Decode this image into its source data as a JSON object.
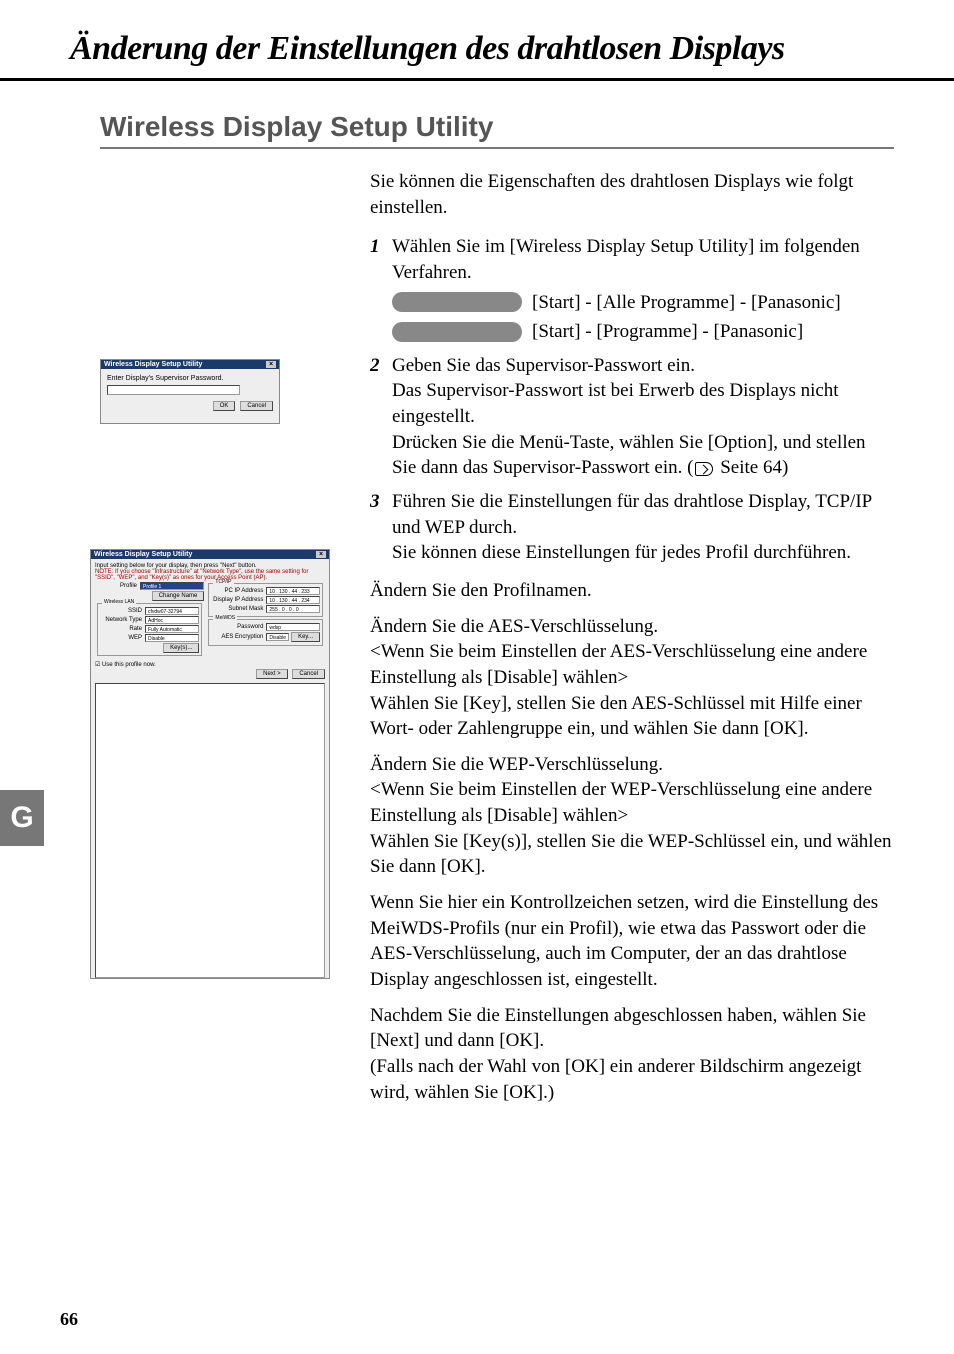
{
  "page_title": "Änderung der Einstellungen des drahtlosen Displays",
  "section_title": "Wireless Display Setup Utility",
  "intro": "Sie können die Eigenschaften des drahtlosen Displays wie folgt einstellen.",
  "side_tab": "G",
  "page_number": "66",
  "pw_dialog": {
    "title": "Wireless Display Setup Utility",
    "prompt": "Enter Display's Supervisor Password.",
    "ok": "OK",
    "cancel": "Cancel"
  },
  "setup_dialog": {
    "title": "Wireless Display Setup Utility",
    "hint1": "Input setting below for your display, then press \"Next\" button.",
    "hint2": "NOTE: If you choose \"Infrastructure\" at \"Network Type\", use the same setting for \"SSID\", \"WEP\", and \"Key(s)\" as ones for your Access Point (AP).",
    "profile_lbl": "Profile",
    "profile_val": "Profile 1",
    "change_name": "Change Name",
    "wlan_legend": "Wireless LAN",
    "ssid_lbl": "SSID",
    "ssid_val": "cfvdw07-32794",
    "nettype_lbl": "Network Type",
    "nettype_val": "AdHoc",
    "rate_lbl": "Rate",
    "rate_val": "Fully Automatic",
    "wep_lbl": "WEP",
    "wep_val": "Disable",
    "keys_btn": "Key(s)...",
    "tcpip_legend": "TCP/IP",
    "pcip_lbl": "PC IP Address",
    "pcip_val": "10 . 130 . 44 . 233",
    "dispip_lbl": "Display IP Address",
    "dispip_val": "10 . 130 . 44 . 234",
    "subnet_lbl": "Subnet Mask",
    "subnet_val": "255 . 0 . 0 . 0",
    "meiwds_legend": "MeiWDS",
    "pw_lbl": "Password",
    "pw_val": "wdsp",
    "aes_lbl": "AES Encryption",
    "aes_val": "Disable",
    "key_btn": "Key...",
    "use_profile": "Use this profile now.",
    "next": "Next >",
    "cancel": "Cancel"
  },
  "steps": {
    "s1": {
      "num": "1",
      "text": "Wählen Sie im [Wireless Display Setup Utility] im folgenden Verfahren.",
      "pill1_text": "[Start] - [Alle Programme] - [Panasonic]",
      "pill2_text": "[Start] - [Programme] - [Panasonic]"
    },
    "s2": {
      "num": "2",
      "line1": "Geben Sie das Supervisor-Passwort ein.",
      "line2": "Das Supervisor-Passwort ist bei Erwerb des Displays nicht eingestellt.",
      "line3a": "Drücken Sie die Menü-Taste, wählen Sie [Option], und stellen Sie dann das Supervisor-Passwort ein. (",
      "line3b": " Seite 64)"
    },
    "s3": {
      "num": "3",
      "line1": "Führen Sie die Einstellungen für das drahtlose Display, TCP/IP und WEP durch.",
      "line2": "Sie können diese Einstellungen für jedes Profil durchführen."
    }
  },
  "callouts": {
    "c1": "Ändern Sie den Profilnamen.",
    "c2a": "Ändern Sie die AES-Verschlüsselung.",
    "c2b": "<Wenn Sie beim Einstellen der AES-Verschlüsselung  eine andere Einstellung als [Disable] wählen>",
    "c2c": "Wählen Sie [Key], stellen Sie den AES-Schlüssel mit Hilfe einer Wort- oder Zahlengruppe ein, und wählen Sie dann [OK].",
    "c3a": "Ändern Sie die WEP-Verschlüsselung.",
    "c3b": "<Wenn Sie beim Einstellen der WEP-Verschlüsselung eine andere Einstellung als [Disable] wählen>",
    "c3c": "Wählen Sie [Key(s)], stellen Sie die WEP-Schlüssel ein, und wählen Sie dann [OK].",
    "c4": "Wenn Sie hier ein Kontrollzeichen setzen, wird die Einstellung des MeiWDS-Profils (nur ein Profil), wie etwa das Passwort oder die AES-Verschlüsselung, auch im Computer, der an das drahtlose Display angeschlossen ist, eingestellt.",
    "final1": "Nachdem Sie die Einstellungen abgeschlossen haben, wählen Sie [Next] und dann [OK].",
    "final2": "(Falls nach der Wahl von [OK] ein anderer Bildschirm angezeigt wird, wählen Sie [OK].)"
  }
}
